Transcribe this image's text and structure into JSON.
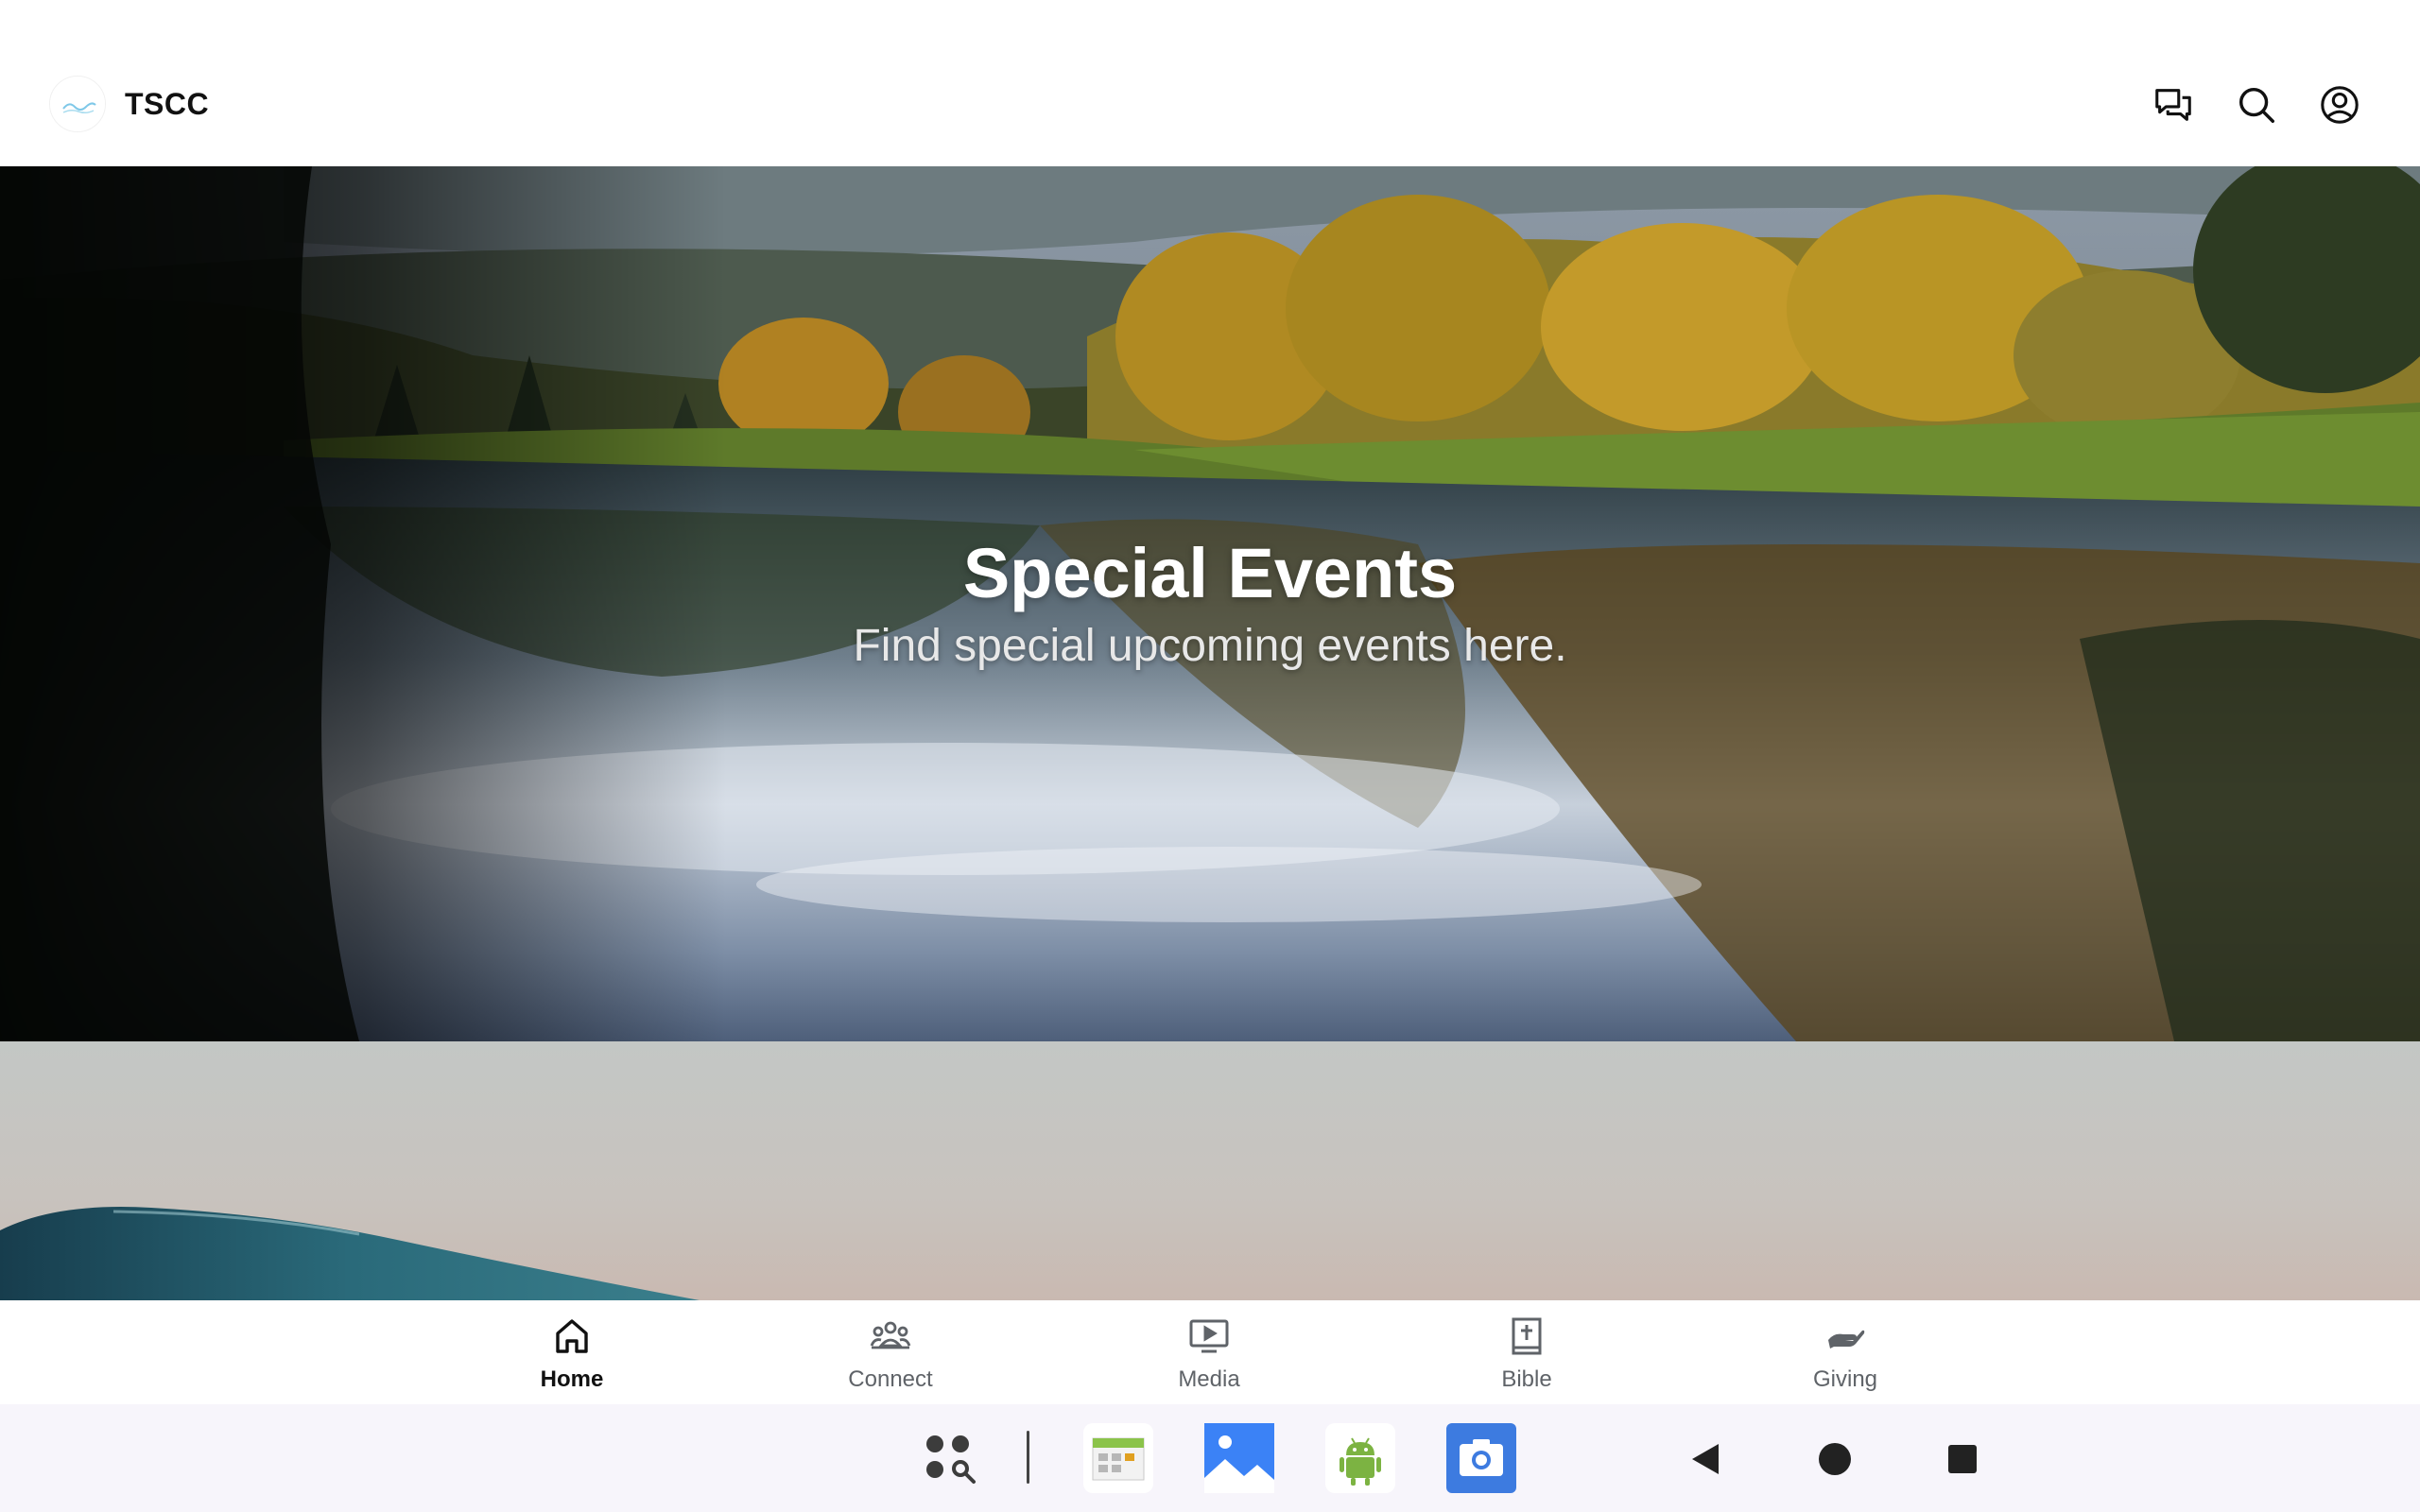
{
  "app": {
    "title": "TSCC"
  },
  "header": {
    "icons": [
      "chat-icon",
      "search-icon",
      "account-icon"
    ]
  },
  "hero": {
    "title": "Special Events",
    "subtitle": "Find special upcoming events here."
  },
  "bottom_nav": {
    "items": [
      {
        "label": "Home",
        "icon": "home-icon",
        "active": true
      },
      {
        "label": "Connect",
        "icon": "people-icon",
        "active": false
      },
      {
        "label": "Media",
        "icon": "play-screen-icon",
        "active": false
      },
      {
        "label": "Bible",
        "icon": "bible-icon",
        "active": false
      },
      {
        "label": "Giving",
        "icon": "giving-hand-icon",
        "active": false
      }
    ]
  },
  "taskbar": {
    "apps": [
      "app-search-icon",
      "calendar-app-icon",
      "gallery-app-icon",
      "android-app-icon",
      "camera-app-icon"
    ],
    "system_buttons": [
      "back-icon",
      "home-circle-icon",
      "recents-icon"
    ]
  },
  "colors": {
    "active_nav": "#111111",
    "inactive_nav": "#5f6368",
    "camera_app": "#3d7be0",
    "gallery_app": "#3b82f6",
    "android_green": "#7cb342"
  }
}
